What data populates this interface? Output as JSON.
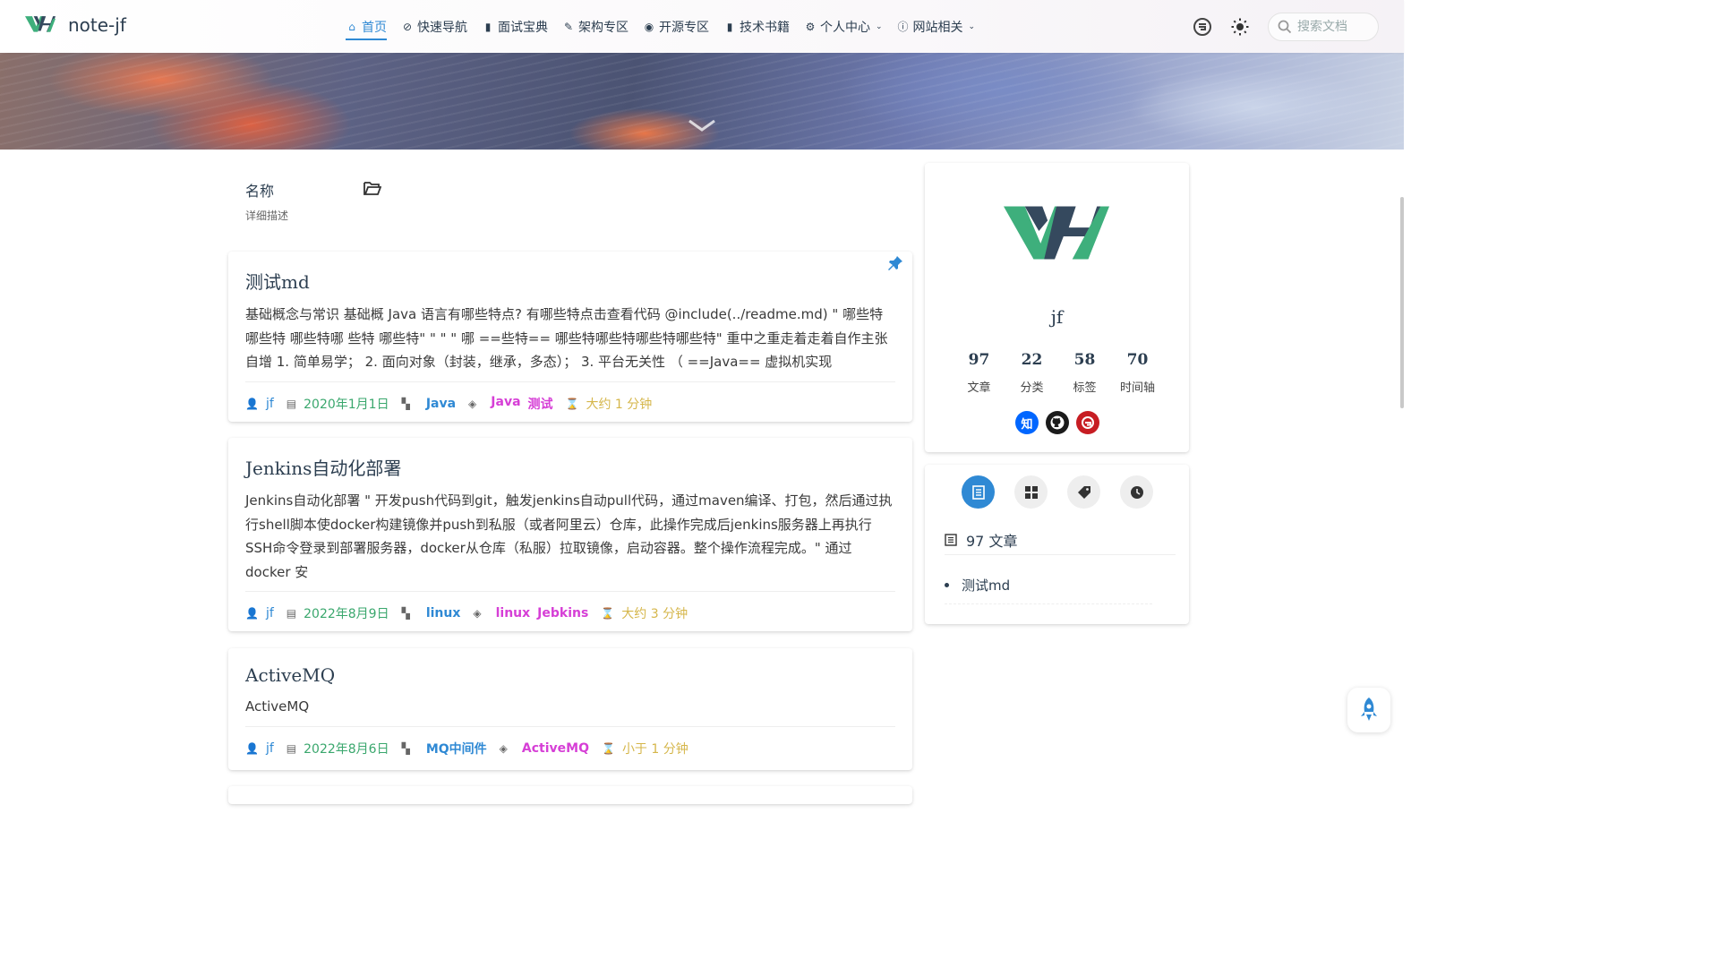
{
  "brand": {
    "name": "note-jf"
  },
  "nav": {
    "items": [
      {
        "label": "首页",
        "icon": "home-icon",
        "active": true
      },
      {
        "label": "快速导航",
        "icon": "compass-icon"
      },
      {
        "label": "面试宝典",
        "icon": "book-icon"
      },
      {
        "label": "架构专区",
        "icon": "edit-icon"
      },
      {
        "label": "开源专区",
        "icon": "github-icon"
      },
      {
        "label": "技术书籍",
        "icon": "book-icon"
      },
      {
        "label": "个人中心",
        "icon": "user-gear-icon",
        "dropdown": true
      },
      {
        "label": "网站相关",
        "icon": "info-icon",
        "dropdown": true
      }
    ],
    "search_placeholder": "搜索文档"
  },
  "category": {
    "title": "名称",
    "description": "详细描述"
  },
  "posts": [
    {
      "title": "测试md",
      "excerpt": "基础概念与常识 基础概 Java 语言有哪些特点? 有哪些特点击查看代码 @include(../readme.md) \" 哪些特哪些特 哪些特哪 些特 哪些特\" \" \" \" 哪 ==些特== 哪些特哪些特哪些特哪些特\" 重中之重走着走着自作主张自增 1. 简单易学； 2. 面向对象（封装，继承，多态）； 3. 平台无关性 （ ==Java== 虚拟机实现",
      "author": "jf",
      "date": "2020年1月1日",
      "category": "Java",
      "tags": [
        "Java",
        "测试"
      ],
      "read_time": "大约 1 分钟",
      "pinned": true
    },
    {
      "title": "Jenkins自动化部署",
      "excerpt": "Jenkins自动化部署 \" 开发push代码到git，触发jenkins自动pull代码，通过maven编译、打包，然后通过执行shell脚本使docker构建镜像并push到私服（或者阿里云）仓库，此操作完成后jenkins服务器上再执行SSH命令登录到部署服务器，docker从仓库（私服）拉取镜像，启动容器。整个操作流程完成。\" 通过docker 安",
      "author": "jf",
      "date": "2022年8月9日",
      "category": "linux",
      "tags": [
        "linux",
        "Jebkins"
      ],
      "read_time": "大约 3 分钟"
    },
    {
      "title": "ActiveMQ",
      "excerpt": "ActiveMQ",
      "author": "jf",
      "date": "2022年8月6日",
      "category": "MQ中间件",
      "tags": [
        "ActiveMQ"
      ],
      "read_time": "小于 1 分钟"
    }
  ],
  "profile": {
    "name": "jf",
    "stats": [
      {
        "value": "97",
        "label": "文章"
      },
      {
        "value": "22",
        "label": "分类"
      },
      {
        "value": "58",
        "label": "标签"
      },
      {
        "value": "70",
        "label": "时间轴"
      }
    ],
    "socials": [
      {
        "name": "zhihu",
        "glyph": "知",
        "color": "#0066ff"
      },
      {
        "name": "github",
        "glyph": "",
        "color": "#1b1b1b"
      },
      {
        "name": "gitee",
        "glyph": "G",
        "color": "#c71d23"
      }
    ]
  },
  "sidebar_tabs": {
    "heading": "97 文章",
    "items": [
      "测试md"
    ]
  },
  "colors": {
    "accent": "#2f89d4",
    "brand_green": "#3eaf7c",
    "brand_dark": "#35495e",
    "date": "#3aa76d",
    "tag": "#d63fd6",
    "time": "#d5b64a"
  }
}
